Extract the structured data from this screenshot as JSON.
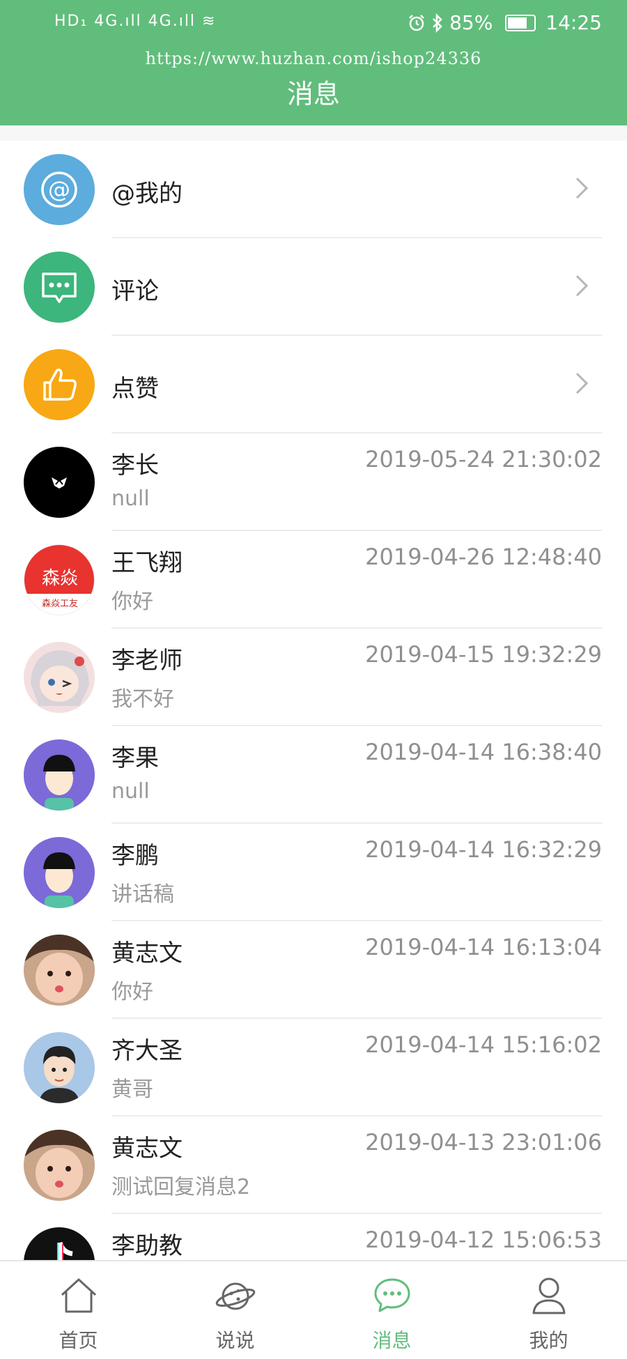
{
  "status_bar": {
    "left": "HD₁ 4G.ıll 4G.ıll ≋",
    "battery": "85%",
    "battery_level": 0.85,
    "time": "14:25"
  },
  "header": {
    "watermark": "https://www.huzhan.com/ishop24336",
    "title": "消息"
  },
  "categories": [
    {
      "label": "@我的",
      "icon": "at-icon",
      "color": "#5cacdd"
    },
    {
      "label": "评论",
      "icon": "comment-icon",
      "color": "#3cb67c"
    },
    {
      "label": "点赞",
      "icon": "thumbs-up-icon",
      "color": "#f7a814"
    }
  ],
  "conversations": [
    {
      "name": "李长",
      "time": "2019-05-24 21:30:02",
      "preview": "null"
    },
    {
      "name": "王飞翔",
      "time": "2019-04-26 12:48:40",
      "preview": "你好",
      "avatar_text": "森焱",
      "avatar_subtext": "森焱工友"
    },
    {
      "name": "李老师",
      "time": "2019-04-15 19:32:29",
      "preview": "我不好"
    },
    {
      "name": "李果",
      "time": "2019-04-14 16:38:40",
      "preview": "null"
    },
    {
      "name": "李鹏",
      "time": "2019-04-14 16:32:29",
      "preview": "讲话稿"
    },
    {
      "name": "黄志文",
      "time": "2019-04-14 16:13:04",
      "preview": "你好"
    },
    {
      "name": "齐大圣",
      "time": "2019-04-14 15:16:02",
      "preview": "黄哥"
    },
    {
      "name": "黄志文",
      "time": "2019-04-13 23:01:06",
      "preview": "测试回复消息2"
    },
    {
      "name": "李助教",
      "time": "2019-04-12 15:06:53",
      "preview": ""
    }
  ],
  "tabbar": {
    "tabs": [
      {
        "label": "首页",
        "icon": "home-icon"
      },
      {
        "label": "说说",
        "icon": "planet-icon"
      },
      {
        "label": "消息",
        "icon": "message-icon",
        "active": true
      },
      {
        "label": "我的",
        "icon": "user-icon"
      }
    ]
  },
  "colors": {
    "brand": "#61bd7c",
    "time_text": "#8f8f8f",
    "preview_text": "#999999"
  }
}
